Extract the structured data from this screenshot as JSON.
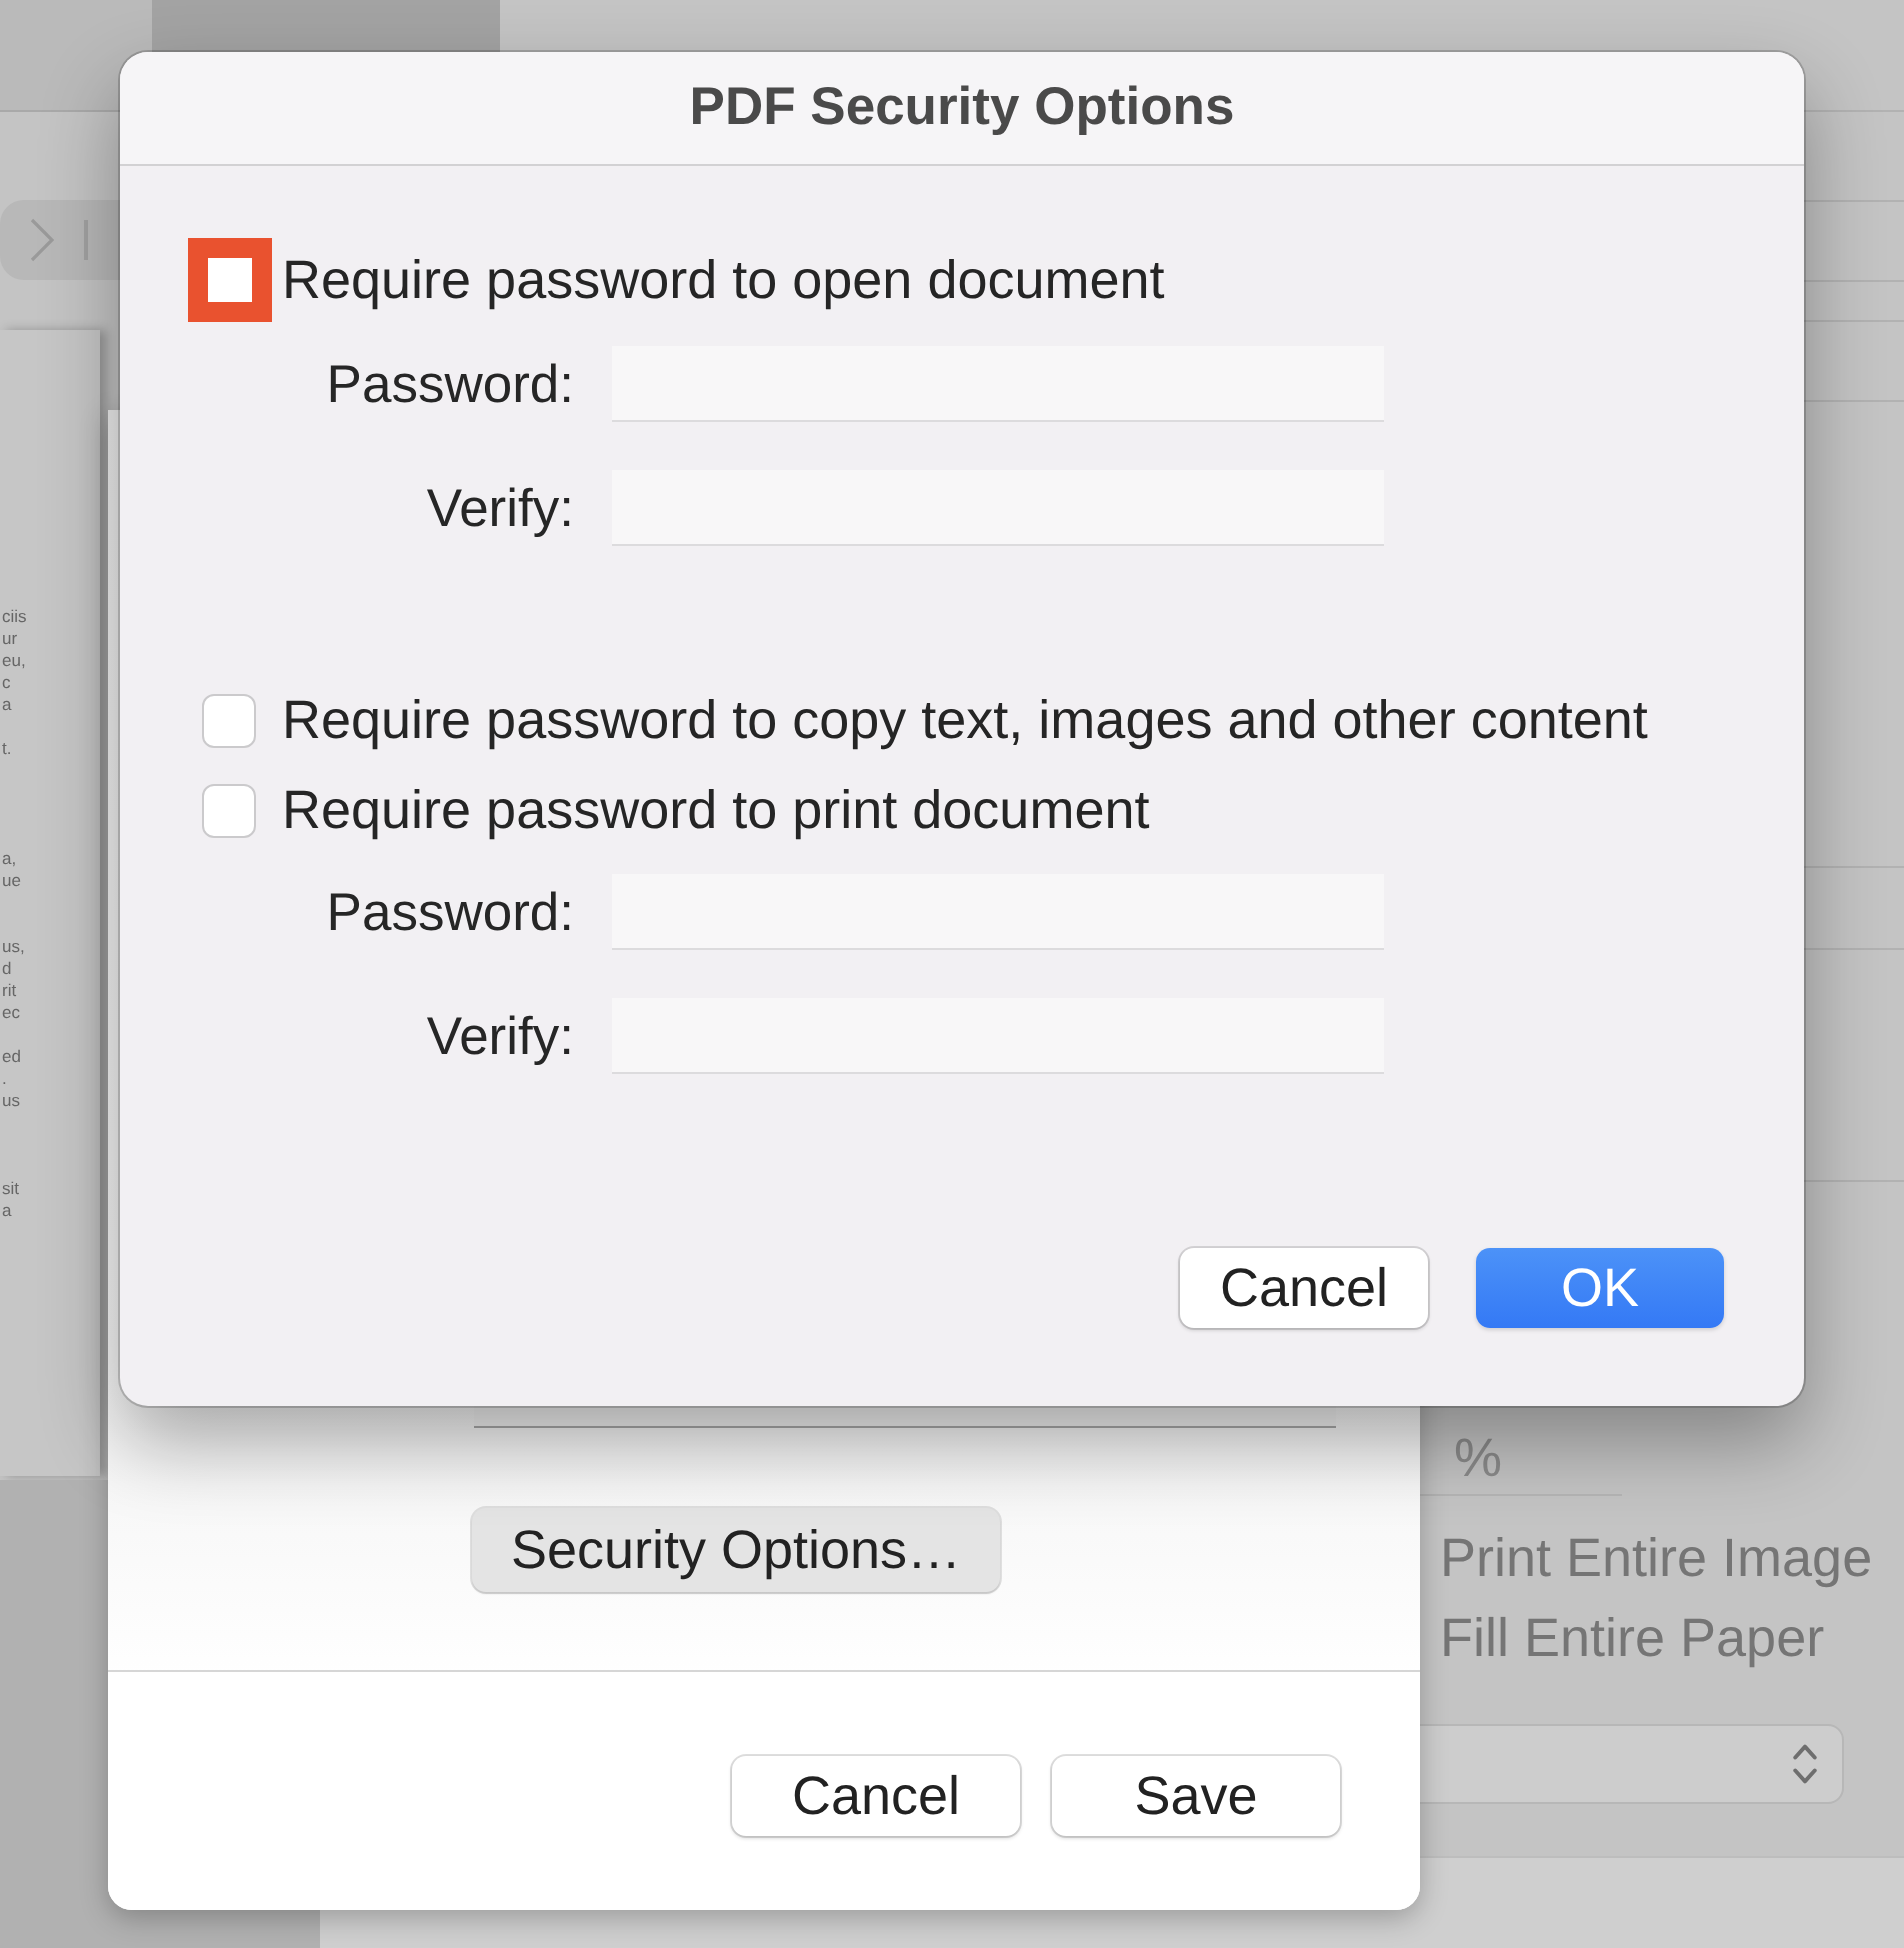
{
  "background": {
    "preview_text": [
      [
        "ciis",
        "ur",
        "eu,",
        "c",
        "a"
      ],
      [
        "t."
      ],
      [
        "a,",
        "ue"
      ],
      [
        "us,",
        "d",
        "rit",
        "ec"
      ],
      [
        "ed",
        ".",
        "us"
      ],
      [
        "sit",
        "a"
      ]
    ],
    "scale_field": {
      "value": "%"
    },
    "scaling_options": [
      {
        "label": "Print Entire Image"
      },
      {
        "label": "Fill Entire Paper"
      }
    ]
  },
  "save_sheet": {
    "security_button": {
      "label": "Security Options…",
      "kind": "tinted"
    },
    "buttons": [
      {
        "label": "Cancel",
        "kind": "secondary"
      },
      {
        "label": "Save",
        "kind": "secondary"
      }
    ]
  },
  "dialog": {
    "title": "PDF Security Options",
    "groups": [
      {
        "options": [
          {
            "label": "Require password to open document",
            "checked": false,
            "highlighted": true
          }
        ],
        "fields": [
          {
            "label": "Password:"
          },
          {
            "label": "Verify:"
          }
        ]
      },
      {
        "options": [
          {
            "label": "Require password to copy text, images and other content",
            "checked": false,
            "highlighted": false
          },
          {
            "label": "Require password to print document",
            "checked": false,
            "highlighted": false
          }
        ],
        "fields": [
          {
            "label": "Password:"
          },
          {
            "label": "Verify:"
          }
        ]
      }
    ],
    "buttons": [
      {
        "label": "Cancel",
        "kind": "secondary"
      },
      {
        "label": "OK",
        "kind": "primary"
      }
    ]
  }
}
